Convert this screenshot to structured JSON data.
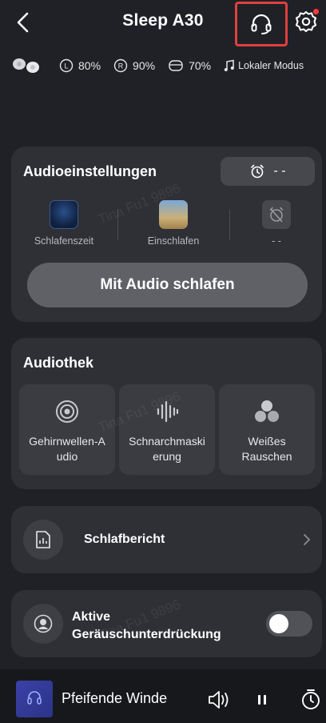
{
  "header": {
    "title": "Sleep A30",
    "icons": [
      "back-arrow-icon",
      "headset-icon",
      "gear-icon"
    ],
    "accent": "#e0403e"
  },
  "status": {
    "left_earbud": "80%",
    "right_earbud": "90%",
    "case": "70%",
    "mode": "Lokaler Modus",
    "left_badge": "L",
    "right_badge": "R"
  },
  "audio_settings": {
    "title": "Audioeinstellungen",
    "alarm_value": "- -",
    "modes": [
      {
        "label": "Schlafenszeit"
      },
      {
        "label": "Einschlafen"
      },
      {
        "label": "- -"
      }
    ],
    "sleep_button": "Mit Audio schlafen"
  },
  "library": {
    "title": "Audiothek",
    "tiles": [
      {
        "label": "Gehirnwellen-A udio",
        "icon": "target-icon"
      },
      {
        "label": "Schnarchmaski erung",
        "icon": "soundwave-icon"
      },
      {
        "label": "Weißes Rauschen",
        "icon": "cluster-icon"
      }
    ]
  },
  "report": {
    "label": "Schlafbericht",
    "icon": "report-icon"
  },
  "anc": {
    "label_line1": "Aktive",
    "label_line2": "Geräuschunterdrückung",
    "enabled": false
  },
  "player": {
    "track": "Pfeifende Winde",
    "icons": [
      "volume-icon",
      "pause-icon",
      "timer-icon"
    ]
  },
  "watermark": "Tina Fu1 9896"
}
